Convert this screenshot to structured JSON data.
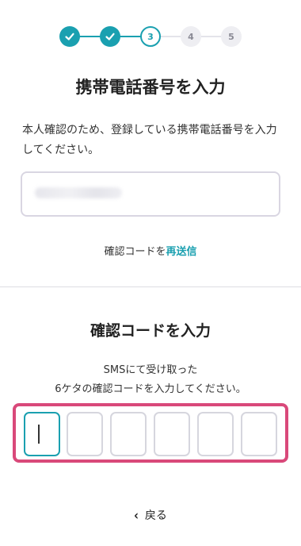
{
  "stepper": {
    "steps": [
      {
        "state": "done",
        "label": ""
      },
      {
        "state": "done",
        "label": ""
      },
      {
        "state": "current",
        "label": "3"
      },
      {
        "state": "todo",
        "label": "4"
      },
      {
        "state": "todo",
        "label": "5"
      }
    ],
    "accent_color": "#1aa0b0"
  },
  "phone_section": {
    "title": "携帯電話番号を入力",
    "description": "本人確認のため、登録している携帯電話番号を入力してください。",
    "resend_prefix": "確認コードを",
    "resend_link": "再送信"
  },
  "code_section": {
    "title": "確認コードを入力",
    "description_line1": "SMSにて受け取った",
    "description_line2": "6ケタの確認コードを入力してください。",
    "highlight_color": "#d9497a"
  },
  "footer": {
    "back_label": "戻る"
  }
}
